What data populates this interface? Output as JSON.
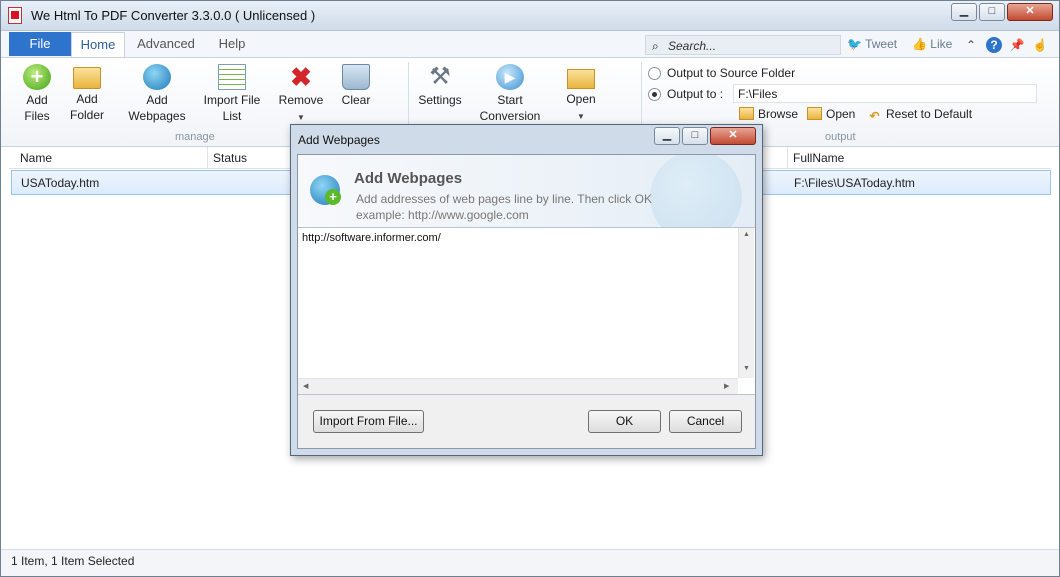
{
  "window": {
    "title": "We Html To PDF Converter 3.3.0.0  ( Unlicensed )"
  },
  "tabs": {
    "file": "File",
    "home": "Home",
    "advanced": "Advanced",
    "help": "Help"
  },
  "search": {
    "placeholder": "Search..."
  },
  "social": {
    "tweet": "Tweet",
    "like": "Like"
  },
  "ribbon": {
    "add_files": "Add\nFiles",
    "add_folder": "Add\nFolder",
    "add_webpages": "Add\nWebpages",
    "import_file_list": "Import File\nList",
    "remove": "Remove",
    "clear": "Clear",
    "manage_group": "manage",
    "settings": "Settings",
    "start_conversion": "Start\nConversion",
    "open": "Open",
    "output_group": "output",
    "output_to_source": "Output to Source Folder",
    "output_to": "Output to :",
    "output_path": "F:\\Files",
    "browse": "Browse",
    "open_small": "Open",
    "reset": "Reset to Default",
    "selected_output": "Output to"
  },
  "grid": {
    "columns": [
      "Name",
      "Status",
      "FullName"
    ],
    "rows": [
      {
        "name": "USAToday.htm",
        "fullname": "F:\\Files\\USAToday.htm"
      }
    ]
  },
  "status": {
    "text": "1 Item, 1 Item Selected"
  },
  "dialog": {
    "title": "Add Webpages",
    "heading": "Add Webpages",
    "description": "Add addresses of web pages line by line. Then click OK example: http://www.google.com",
    "url_text": "http://software.informer.com/",
    "import_button": "Import From File...",
    "ok_button": "OK",
    "cancel_button": "Cancel"
  },
  "colors": {
    "accent": "#2f74cc",
    "selection": "#dcebfb",
    "close": "#c34a33"
  }
}
